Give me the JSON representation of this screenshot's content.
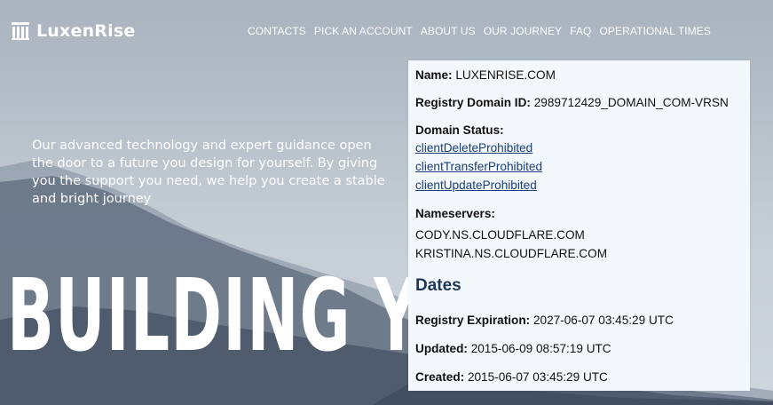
{
  "brand": {
    "name": "LuxenRise",
    "icon": "building-columns-icon"
  },
  "nav": {
    "items": [
      "CONTACTS",
      "PICK AN ACCOUNT",
      "ABOUT US",
      "OUR JOURNEY",
      "FAQ",
      "OPERATIONAL TIMES"
    ]
  },
  "hero": {
    "tagline": "Our advanced technology and expert guidance open the door to a future you design for yourself. By giving you the support you need, we help you create a stable and bright journey",
    "headline": "BUILDING Y"
  },
  "whois": {
    "name_label": "Name:",
    "name_value": "LUXENRISE.COM",
    "registry_id_label": "Registry Domain ID:",
    "registry_id_value": "2989712429_DOMAIN_COM-VRSN",
    "status_label": "Domain Status:",
    "statuses": [
      "clientDeleteProhibited",
      "clientTransferProhibited",
      "clientUpdateProhibited"
    ],
    "nameservers_label": "Nameservers:",
    "nameservers": [
      "CODY.NS.CLOUDFLARE.COM",
      "KRISTINA.NS.CLOUDFLARE.COM"
    ],
    "dates_title": "Dates",
    "expiration_label": "Registry Expiration:",
    "expiration_value": "2027-06-07 03:45:29 UTC",
    "updated_label": "Updated:",
    "updated_value": "2015-06-09 08:57:19 UTC",
    "created_label": "Created:",
    "created_value": "2015-06-07 03:45:29 UTC"
  },
  "colors": {
    "panel_bg": "#f2f8fc",
    "link": "#1a3e7a",
    "dates_heading": "#1d3557",
    "header_text": "#ffffff"
  }
}
